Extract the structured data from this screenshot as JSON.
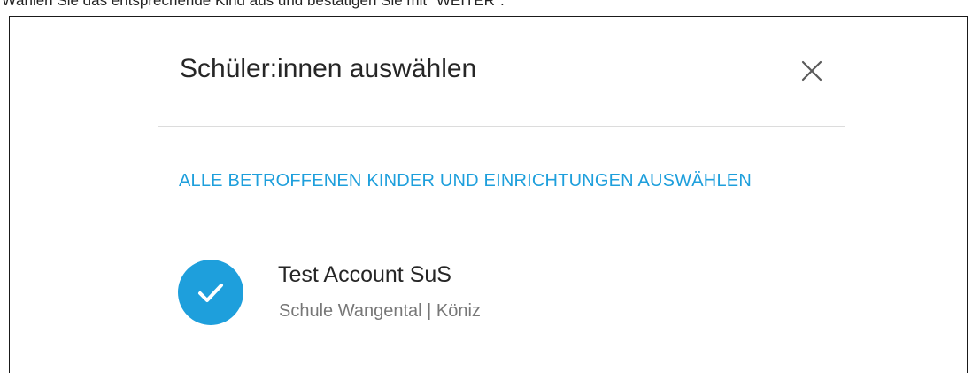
{
  "instruction": {
    "text": "Wählen Sie das entsprechende Kind aus und bestätigen Sie mit \"WEITER\"."
  },
  "dialog": {
    "title": "Schüler:innen auswählen",
    "close_icon": "close-icon",
    "select_all_label": "ALLE BETROFFENEN KINDER UND EINRICHTUNGEN AUSWÄHLEN",
    "students": [
      {
        "name": "Test Account SuS",
        "subtitle": "Schule Wangental | Köniz",
        "selected": true,
        "icon": "check-icon"
      }
    ]
  },
  "colors": {
    "accent": "#1e9fdc",
    "title_text": "#262626",
    "secondary_text": "#777777",
    "divider": "#dcdcdc"
  }
}
